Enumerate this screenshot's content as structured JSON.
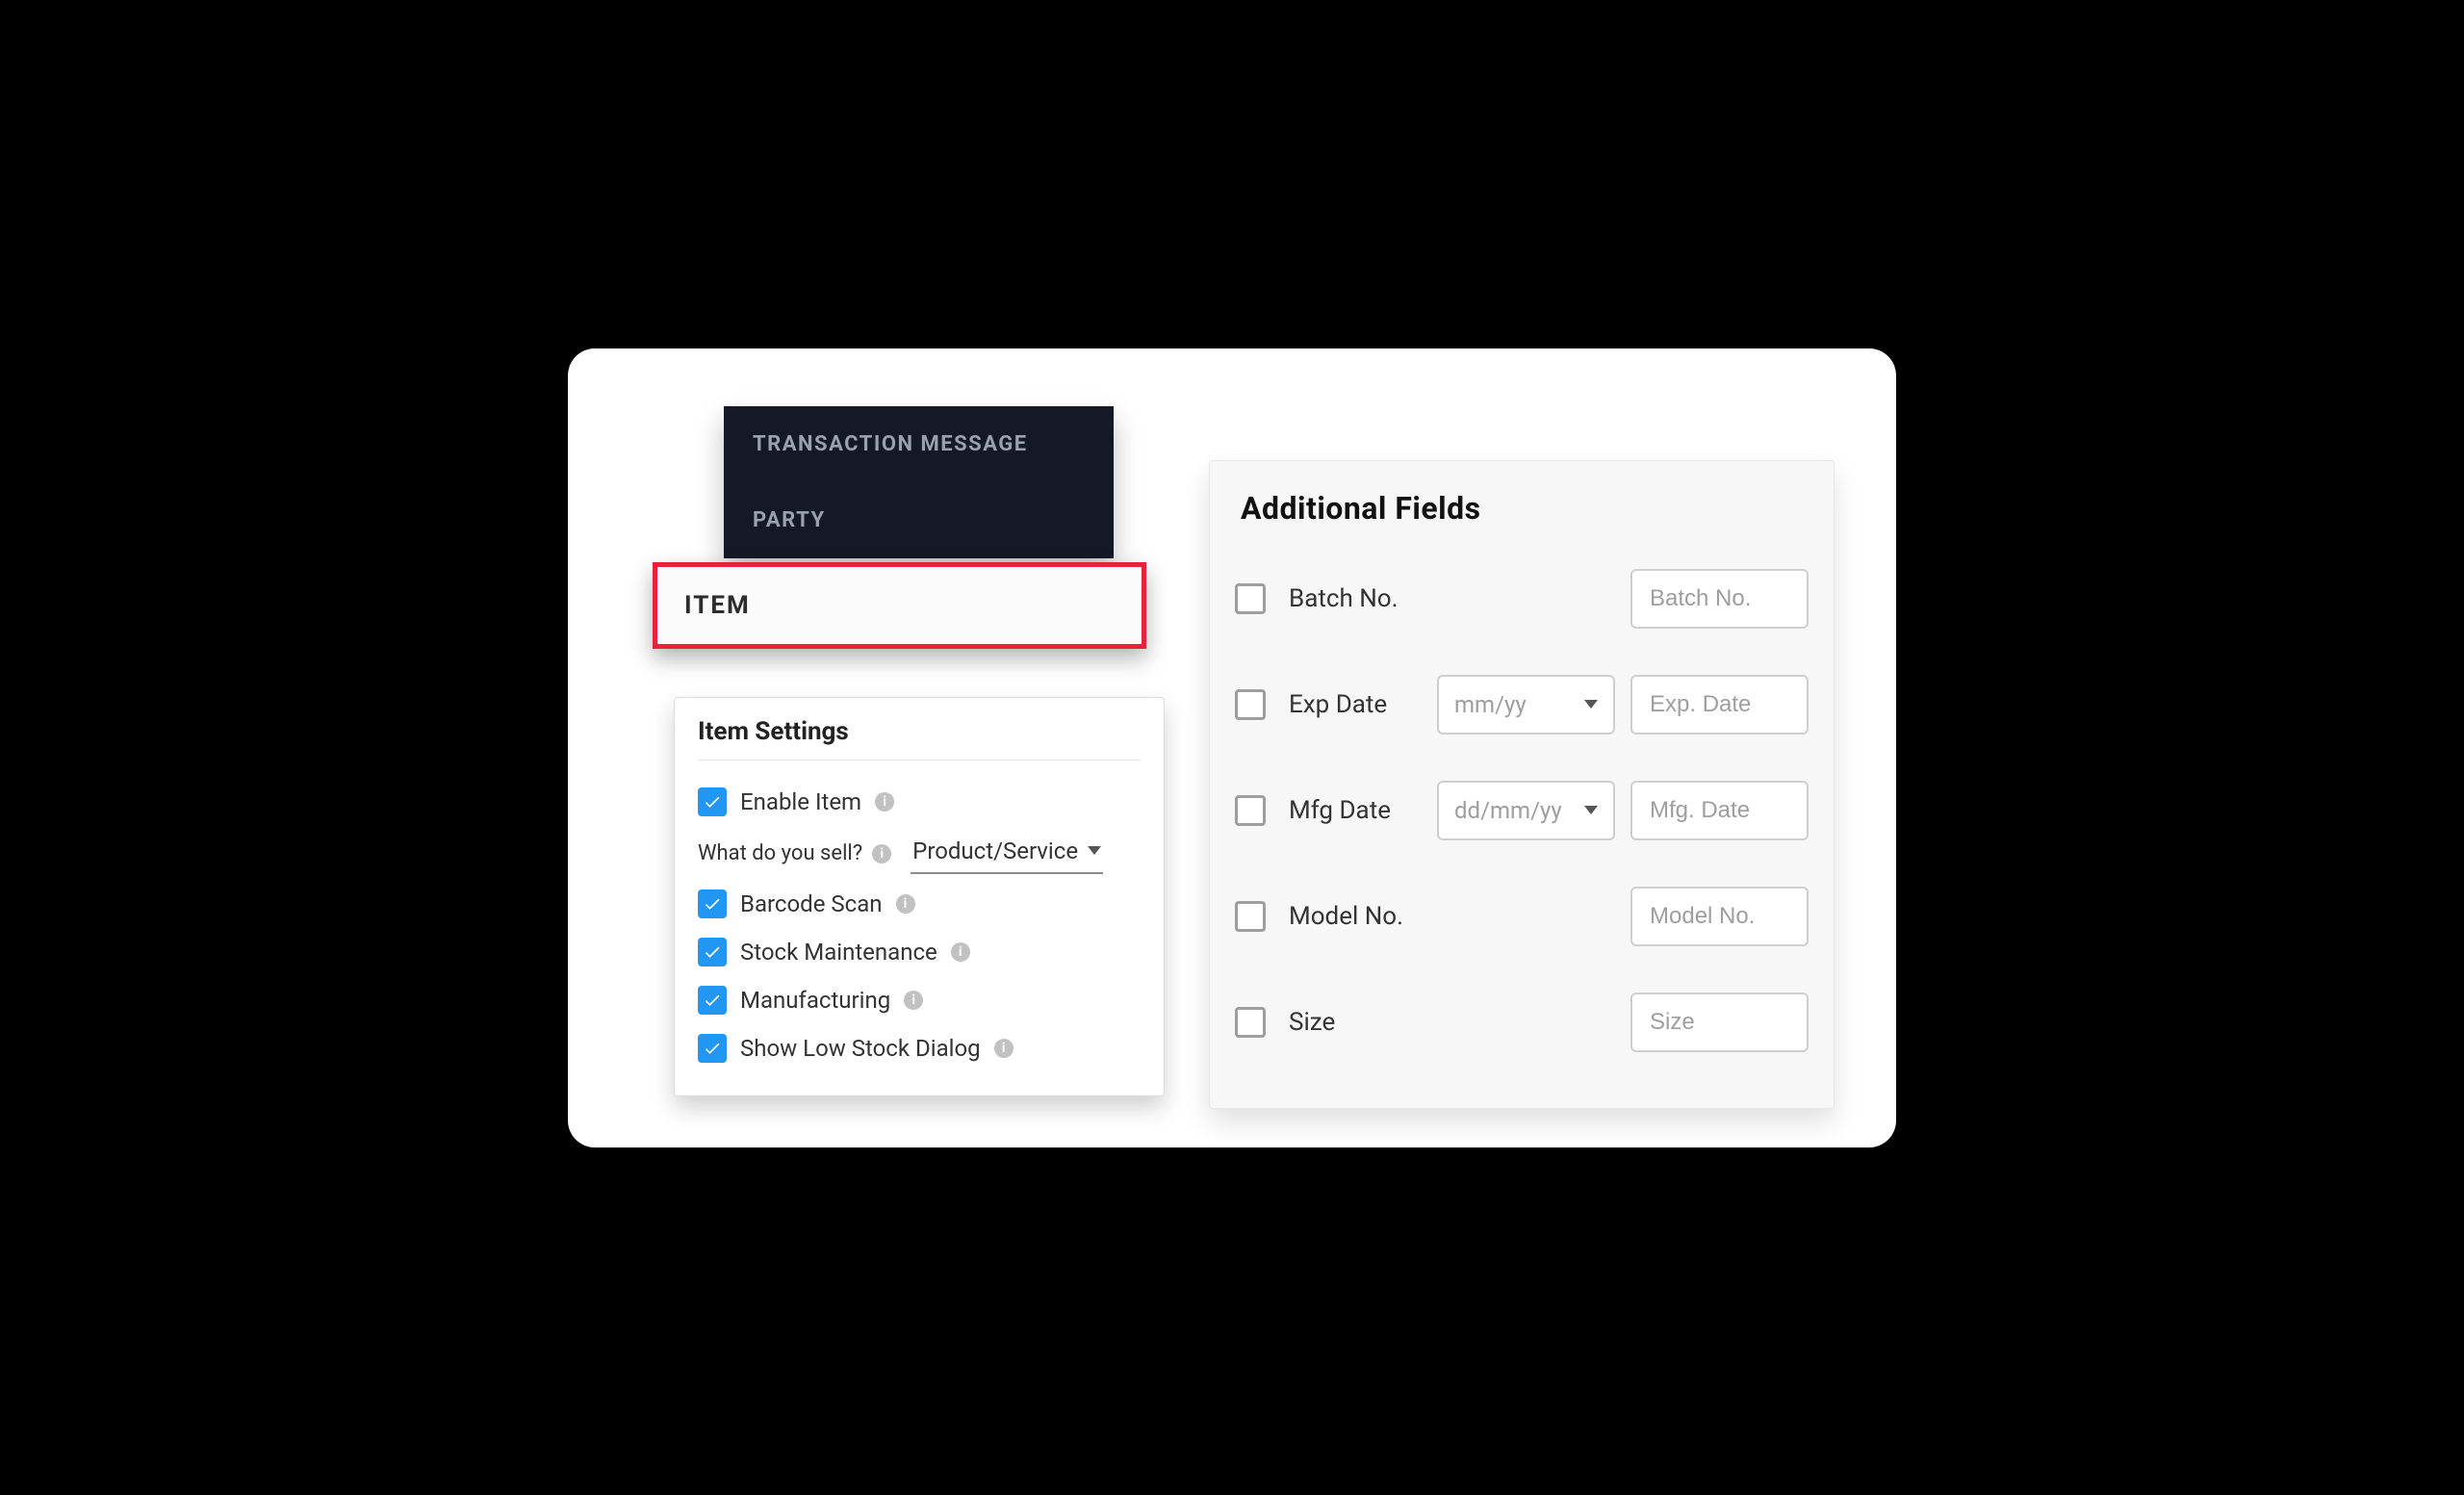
{
  "nav": {
    "items": [
      {
        "label": "TRANSACTION MESSAGE"
      },
      {
        "label": "PARTY"
      }
    ],
    "selected": "ITEM"
  },
  "settings": {
    "title": "Item Settings",
    "enable_item": "Enable Item",
    "what_sell": "What do you sell?",
    "sell_value": "Product/Service",
    "barcode": "Barcode Scan",
    "stock": "Stock Maintenance",
    "manufacturing": "Manufacturing",
    "low_stock": "Show Low Stock Dialog"
  },
  "addl": {
    "title": "Additional Fields",
    "rows": {
      "batch": {
        "label": "Batch No.",
        "placeholder": "Batch No."
      },
      "exp": {
        "label": "Exp Date",
        "format": "mm/yy",
        "placeholder": "Exp. Date"
      },
      "mfg": {
        "label": "Mfg Date",
        "format": "dd/mm/yy",
        "placeholder": "Mfg. Date"
      },
      "model": {
        "label": "Model No.",
        "placeholder": "Model No."
      },
      "size": {
        "label": "Size",
        "placeholder": "Size"
      }
    }
  },
  "icons": {
    "info_glyph": "i"
  }
}
